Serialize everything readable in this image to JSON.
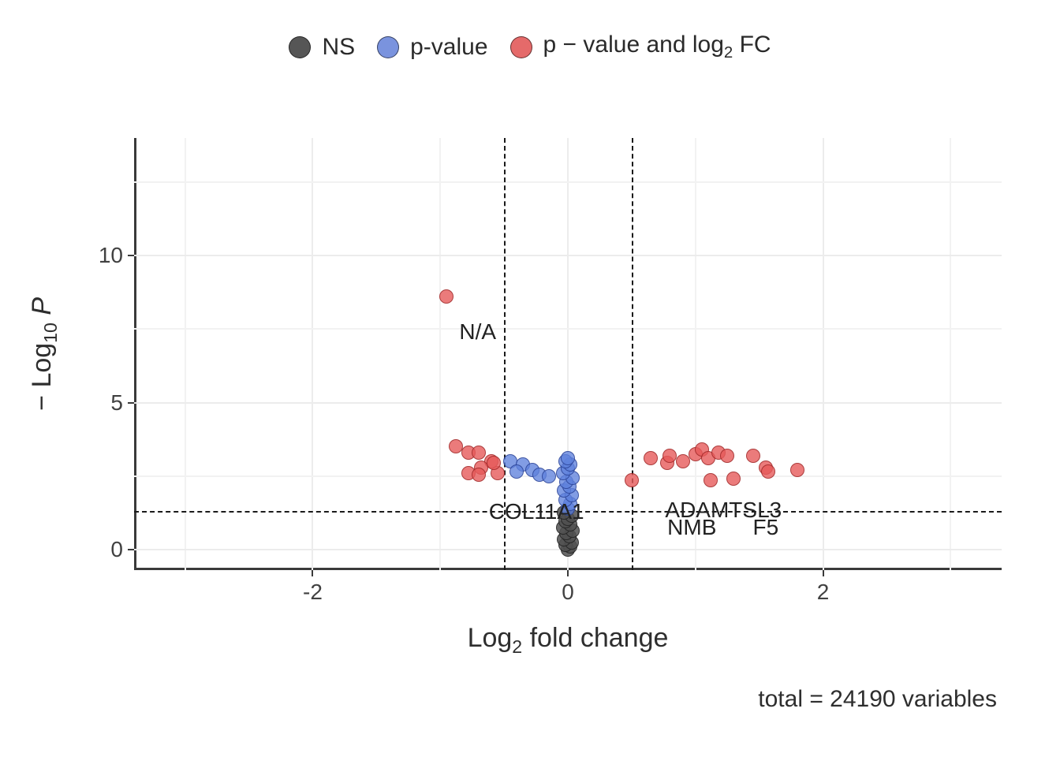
{
  "chart_data": {
    "type": "scatter",
    "title": "",
    "xlabel_html": "Log<sub>2</sub> fold change",
    "ylabel_html": "− Log<sub>10</sub> <i>P</i>",
    "xlim": [
      -3.4,
      3.4
    ],
    "ylim": [
      -0.7,
      14
    ],
    "x_ticks": [
      -2,
      0,
      2
    ],
    "y_ticks": [
      0,
      5,
      10
    ],
    "vlines": [
      -0.5,
      0.5
    ],
    "hlines": [
      1.3
    ],
    "caption": "total = 24190 variables",
    "legend": [
      {
        "label": "NS",
        "color": "#565656"
      },
      {
        "label": "p-value",
        "color": "#6a86d6"
      },
      {
        "label_html": "p − value and log<sub>2</sub> FC",
        "color": "#e25c5c"
      }
    ],
    "series": [
      {
        "name": "NS",
        "class": "ns",
        "points": [
          {
            "x": 0.0,
            "y": 0.0
          },
          {
            "x": 0.02,
            "y": 0.1
          },
          {
            "x": -0.02,
            "y": 0.15
          },
          {
            "x": 0.03,
            "y": 0.25
          },
          {
            "x": -0.03,
            "y": 0.35
          },
          {
            "x": 0.01,
            "y": 0.45
          },
          {
            "x": -0.01,
            "y": 0.55
          },
          {
            "x": 0.04,
            "y": 0.65
          },
          {
            "x": -0.04,
            "y": 0.75
          },
          {
            "x": 0.02,
            "y": 0.85
          },
          {
            "x": -0.02,
            "y": 0.95
          },
          {
            "x": 0.0,
            "y": 1.05
          },
          {
            "x": 0.03,
            "y": 1.15
          },
          {
            "x": -0.03,
            "y": 1.25
          }
        ]
      },
      {
        "name": "p-value",
        "class": "blue",
        "points": [
          {
            "x": 0.0,
            "y": 1.4
          },
          {
            "x": 0.02,
            "y": 1.55
          },
          {
            "x": -0.02,
            "y": 1.7
          },
          {
            "x": 0.03,
            "y": 1.85
          },
          {
            "x": -0.03,
            "y": 2.0
          },
          {
            "x": 0.01,
            "y": 2.15
          },
          {
            "x": -0.01,
            "y": 2.3
          },
          {
            "x": 0.04,
            "y": 2.45
          },
          {
            "x": -0.04,
            "y": 2.6
          },
          {
            "x": 0.0,
            "y": 2.75
          },
          {
            "x": 0.02,
            "y": 2.9
          },
          {
            "x": -0.02,
            "y": 3.0
          },
          {
            "x": 0.0,
            "y": 3.1
          },
          {
            "x": -0.45,
            "y": 3.0
          },
          {
            "x": -0.35,
            "y": 2.9
          },
          {
            "x": -0.28,
            "y": 2.7
          },
          {
            "x": -0.22,
            "y": 2.55
          },
          {
            "x": -0.4,
            "y": 2.65
          },
          {
            "x": -0.15,
            "y": 2.5
          }
        ]
      },
      {
        "name": "p-value and log2 FC",
        "class": "red",
        "points": [
          {
            "x": -0.95,
            "y": 8.6
          },
          {
            "x": -0.88,
            "y": 3.5
          },
          {
            "x": -0.78,
            "y": 3.3
          },
          {
            "x": -0.7,
            "y": 3.3
          },
          {
            "x": -0.6,
            "y": 3.0
          },
          {
            "x": -0.68,
            "y": 2.8
          },
          {
            "x": -0.78,
            "y": 2.6
          },
          {
            "x": -0.55,
            "y": 2.6
          },
          {
            "x": -0.58,
            "y": 2.95
          },
          {
            "x": -0.7,
            "y": 2.55
          },
          {
            "x": 0.5,
            "y": 2.35
          },
          {
            "x": 0.65,
            "y": 3.1
          },
          {
            "x": 0.78,
            "y": 2.95
          },
          {
            "x": 0.8,
            "y": 3.2
          },
          {
            "x": 0.9,
            "y": 3.0
          },
          {
            "x": 1.0,
            "y": 3.25
          },
          {
            "x": 1.05,
            "y": 3.4
          },
          {
            "x": 1.1,
            "y": 3.1
          },
          {
            "x": 1.12,
            "y": 2.35
          },
          {
            "x": 1.18,
            "y": 3.3
          },
          {
            "x": 1.25,
            "y": 3.2
          },
          {
            "x": 1.3,
            "y": 2.4
          },
          {
            "x": 1.45,
            "y": 3.2
          },
          {
            "x": 1.55,
            "y": 2.8
          },
          {
            "x": 1.57,
            "y": 2.65
          },
          {
            "x": 1.8,
            "y": 2.7
          }
        ]
      }
    ],
    "labels": [
      {
        "text": "N/A",
        "x": -0.9,
        "y": 8.1,
        "dx": 8,
        "dy": 10
      },
      {
        "text": "COL11A1",
        "x": -0.62,
        "y": 2.1,
        "dx": 0,
        "dy": 14
      },
      {
        "text": "ADAMTSL3",
        "x": 0.8,
        "y": 2.15,
        "dx": -6,
        "dy": 14
      },
      {
        "text": "NMB",
        "x": 0.78,
        "y": 1.55,
        "dx": 0,
        "dy": 14
      },
      {
        "text": "F5",
        "x": 1.45,
        "y": 1.55,
        "dx": 0,
        "dy": 14
      }
    ]
  }
}
